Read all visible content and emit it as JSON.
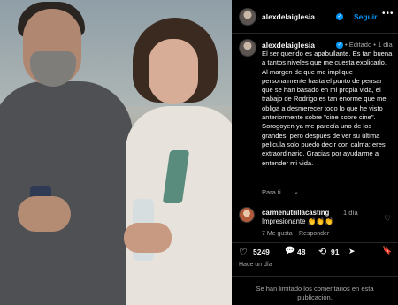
{
  "post": {
    "author": "alexdelaiglesia",
    "follow_label": "Seguir",
    "more_label": "•••",
    "verified_mark": "✓"
  },
  "caption": {
    "author": "alexdelaiglesia",
    "meta": "• Editado • 1 día",
    "text": "El ser querido es apabullante. Es tan buena a tantos niveles que me cuesta explicarlo. Al margen de que me implique personalmente hasta el punto de pensar que se han basado en mi propia vida, el trabajo de Rodrigo es tan enorme que me obliga a desmerecer todo lo que he visto anteriormente sobre \"cine sobre cine\". Sorogoyen ya me parecía uno de los grandes, pero después de ver su última película solo puedo decir con calma: eres extraordinario. Gracias por ayudarme a entender mi vida.",
    "translate_label": "Para ti",
    "translate_chevron": "⌄"
  },
  "comment": {
    "author": "carmenutrillacasting",
    "time": "1 día",
    "text": "Impresionante 👏👏👏",
    "likes": "7 Me gusta",
    "reply_label": "Responder",
    "like_icon": "♡"
  },
  "actions": {
    "like_icon": "♡",
    "likes": "5249",
    "comment_icon": "💬",
    "comments": "48",
    "repost_icon": "⟲",
    "reposts": "91",
    "share_icon": "➤",
    "save_icon": "🔖"
  },
  "time_ago": "Hace un día",
  "comments_limited": "Se han limitado los comentarios en esta publicación.",
  "colors": {
    "background": "#000000",
    "link_blue": "#0095f6",
    "muted_text": "#a8a8a8"
  }
}
